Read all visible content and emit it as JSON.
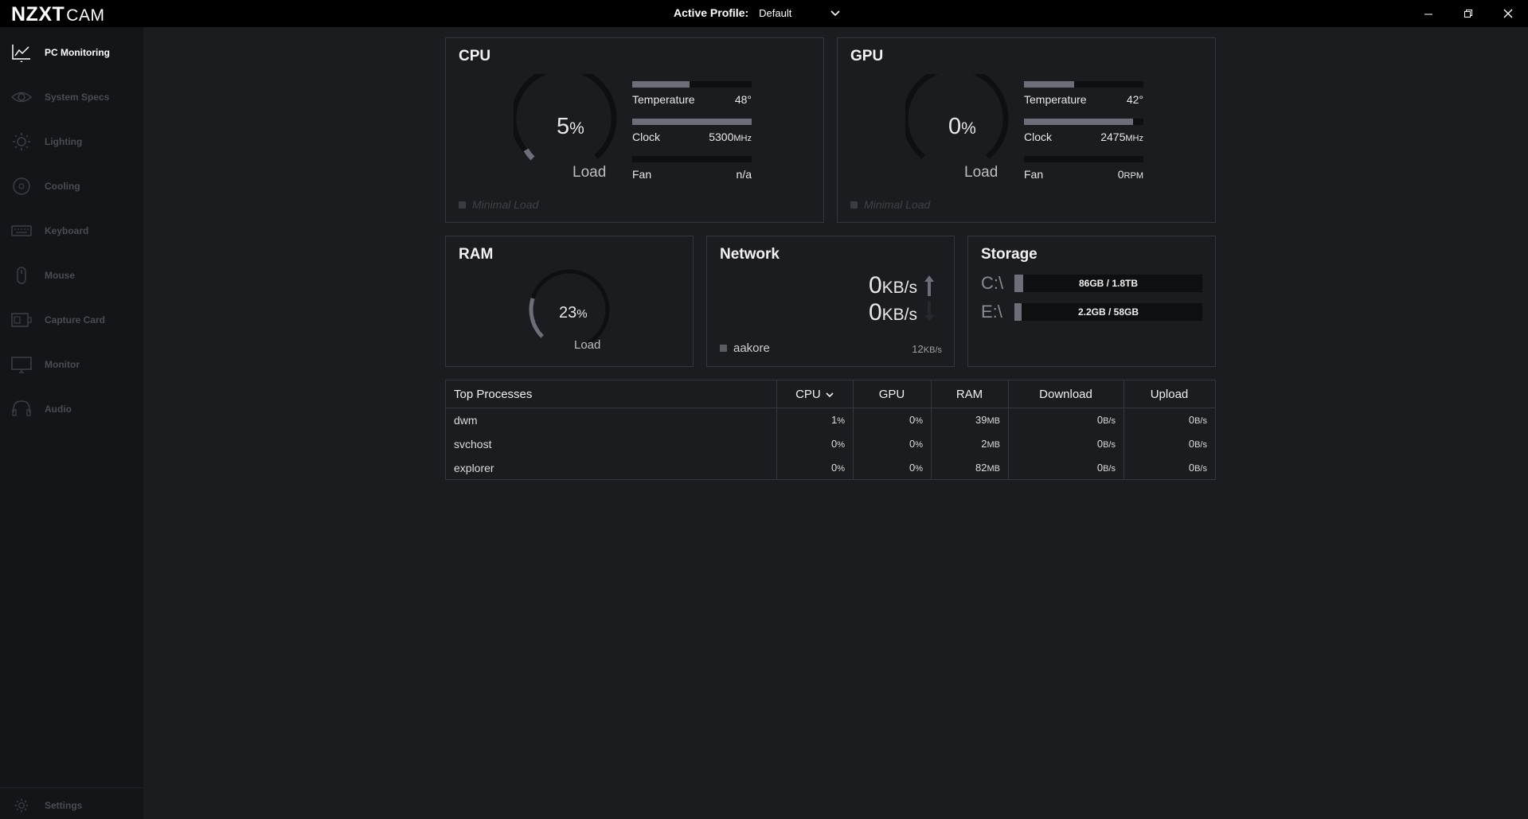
{
  "app": {
    "brand": "NZXT",
    "product": "CAM"
  },
  "profile": {
    "label": "Active Profile:",
    "value": "Default"
  },
  "sidebar": {
    "items": [
      {
        "label": "PC Monitoring",
        "icon": "line-chart-icon",
        "active": true
      },
      {
        "label": "System Specs",
        "icon": "eye-icon",
        "active": false
      },
      {
        "label": "Lighting",
        "icon": "sun-icon",
        "active": false
      },
      {
        "label": "Cooling",
        "icon": "fan-icon",
        "active": false
      },
      {
        "label": "Keyboard",
        "icon": "keyboard-icon",
        "active": false
      },
      {
        "label": "Mouse",
        "icon": "mouse-icon",
        "active": false
      },
      {
        "label": "Capture Card",
        "icon": "capture-card-icon",
        "active": false
      },
      {
        "label": "Monitor",
        "icon": "monitor-icon",
        "active": false
      },
      {
        "label": "Audio",
        "icon": "headset-icon",
        "active": false
      }
    ],
    "settings": {
      "label": "Settings",
      "icon": "gear-icon"
    }
  },
  "cpu": {
    "title": "CPU",
    "load_value": "5",
    "load_unit": "%",
    "load_label": "Load",
    "load_fraction": 0.05,
    "temperature": {
      "label": "Temperature",
      "value": "48°",
      "fill": 0.48
    },
    "clock": {
      "label": "Clock",
      "value": "5300",
      "unit": "MHz",
      "fill": 1.0
    },
    "fan": {
      "label": "Fan",
      "value": "n/a",
      "unit": "",
      "fill": 0
    },
    "status": "Minimal Load"
  },
  "gpu": {
    "title": "GPU",
    "load_value": "0",
    "load_unit": "%",
    "load_label": "Load",
    "load_fraction": 0.0,
    "temperature": {
      "label": "Temperature",
      "value": "42°",
      "fill": 0.42
    },
    "clock": {
      "label": "Clock",
      "value": "2475",
      "unit": "MHz",
      "fill": 0.91
    },
    "fan": {
      "label": "Fan",
      "value": "0",
      "unit": "RPM",
      "fill": 0
    },
    "status": "Minimal Load"
  },
  "ram": {
    "title": "RAM",
    "load_value": "23",
    "load_unit": "%",
    "load_label": "Load",
    "load_fraction": 0.23
  },
  "network": {
    "title": "Network",
    "up_value": "0",
    "up_unit": "KB/s",
    "down_value": "0",
    "down_unit": "KB/s",
    "adapter": "aakore",
    "total_value": "12",
    "total_unit": "KB/s"
  },
  "storage": {
    "title": "Storage",
    "drives": [
      {
        "letter": "C:\\",
        "text": "86GB / 1.8TB",
        "fill": 0.046
      },
      {
        "letter": "E:\\",
        "text": "2.2GB / 58GB",
        "fill": 0.038
      }
    ]
  },
  "processes": {
    "title": "Top Processes",
    "headers": {
      "cpu": "CPU",
      "gpu": "GPU",
      "ram": "RAM",
      "download": "Download",
      "upload": "Upload"
    },
    "sort_column": "cpu",
    "rows": [
      {
        "name": "dwm",
        "cpu": "1",
        "gpu": "0",
        "ram": "39",
        "download": "0",
        "upload": "0"
      },
      {
        "name": "svchost",
        "cpu": "0",
        "gpu": "0",
        "ram": "2",
        "download": "0",
        "upload": "0"
      },
      {
        "name": "explorer",
        "cpu": "0",
        "gpu": "0",
        "ram": "82",
        "download": "0",
        "upload": "0"
      }
    ],
    "units": {
      "pct": "%",
      "ram": "MB",
      "rate": "B/s"
    }
  },
  "colors": {
    "background": "#1b1c1f",
    "sidebar": "#141518",
    "bar_fill": "#6c6e7a",
    "border": "#34363c"
  }
}
